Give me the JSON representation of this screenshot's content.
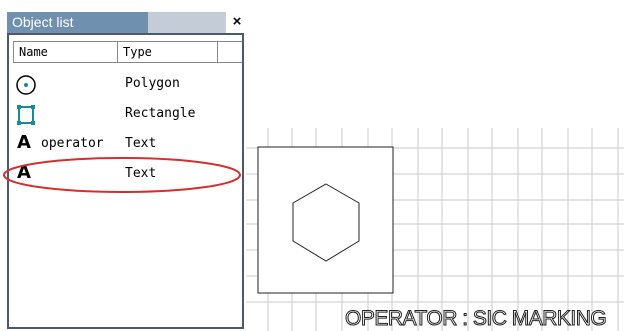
{
  "panel": {
    "title": "Object list",
    "close_label": "×",
    "columns": {
      "name": "Name",
      "type": "Type"
    },
    "rows": [
      {
        "name": "",
        "type": "Polygon",
        "icon": "polygon-icon"
      },
      {
        "name": "",
        "type": "Rectangle",
        "icon": "rectangle-icon"
      },
      {
        "name": "operator",
        "type": "Text",
        "icon": "text-icon",
        "glyph": "A"
      },
      {
        "name": "",
        "type": "Text",
        "icon": "text-icon",
        "glyph": "A",
        "highlighted": true
      }
    ]
  },
  "canvas": {
    "marking_text": "OPERATOR : SIC MARKING"
  },
  "colors": {
    "titlebar": "#7090b0",
    "highlight": "#d03030",
    "grid": "#c8c8c8",
    "icon_accent": "#1a8a9a"
  }
}
